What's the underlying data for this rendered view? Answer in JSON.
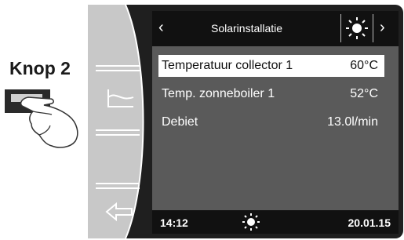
{
  "callout": {
    "label": "Knop 2"
  },
  "header": {
    "title": "Solarinstallatie",
    "back_icon": "chevron-left-icon",
    "forward_icon": "chevron-right-icon",
    "sun_icon": "sun-icon"
  },
  "rows": [
    {
      "label": "Temperatuur collector 1",
      "value": "60°C",
      "selected": true
    },
    {
      "label": "Temp. zonneboiler 1",
      "value": "52°C",
      "selected": false
    },
    {
      "label": "Debiet",
      "value": "13.0l/min",
      "selected": false
    }
  ],
  "footer": {
    "time": "14:12",
    "date": "20.01.15",
    "sun_icon": "sun-icon"
  },
  "side_buttons": [
    {
      "icon": "curve-chart-icon"
    },
    {
      "icon": "back-arrow-icon"
    }
  ],
  "colors": {
    "screen_bg": "#5a5a5a",
    "bar_bg": "#111111",
    "device_bg": "#1f1f1f",
    "highlight": "#ffffff"
  }
}
